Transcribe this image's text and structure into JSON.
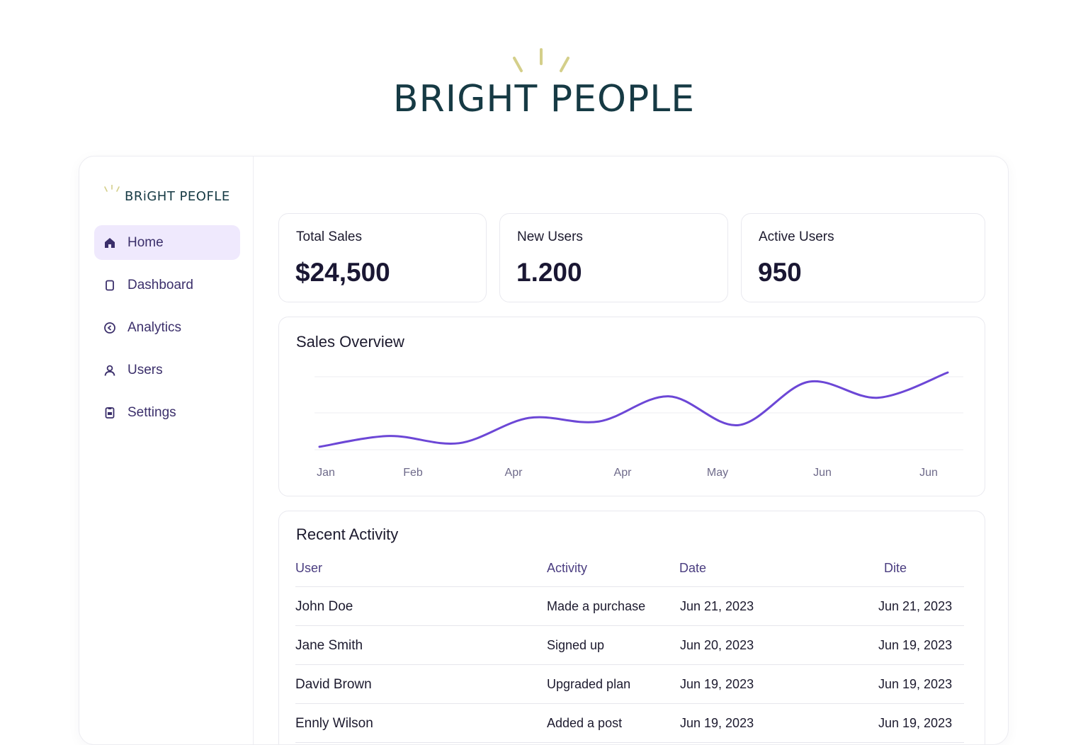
{
  "brand": {
    "name": "BRIGHT PEOPLE",
    "colors": {
      "primary": "#163a44",
      "rays": "#d4cf8a",
      "accent": "#6c47d6"
    }
  },
  "sidebar": {
    "logo_text": "BRiGHT PEOFLE",
    "items": [
      {
        "label": "Home",
        "icon": "home-icon",
        "active": true
      },
      {
        "label": "Dashboard",
        "icon": "dashboard-icon",
        "active": false
      },
      {
        "label": "Analytics",
        "icon": "analytics-icon",
        "active": false
      },
      {
        "label": "Users",
        "icon": "user-icon",
        "active": false
      },
      {
        "label": "Settings",
        "icon": "settings-icon",
        "active": false
      }
    ]
  },
  "stats": [
    {
      "label": "Total Sales",
      "value": "$24,500"
    },
    {
      "label": "New Users",
      "value": "1.200"
    },
    {
      "label": "Active Users",
      "value": "950"
    }
  ],
  "chart_data": {
    "type": "line",
    "title": "Sales Overview",
    "categories": [
      "Jan",
      "Feb",
      "Apr",
      "Apr",
      "May",
      "Jun",
      "Jun"
    ],
    "series": [
      {
        "values": [
          0.05,
          0.2,
          0.1,
          0.45,
          0.4,
          0.75,
          0.35,
          0.95,
          0.73,
          1.08
        ]
      }
    ],
    "grid": true,
    "color": "#6c47d6"
  },
  "activity": {
    "title": "Recent Activity",
    "columns": [
      "User",
      "Activity",
      "Date",
      "Dite"
    ],
    "rows": [
      {
        "user": "John Doe",
        "activity": "Made a purchase",
        "date": "Jun 21, 2023",
        "date2": "Jun 21, 2023"
      },
      {
        "user": "Jane Smith",
        "activity": "Signed up",
        "date": "Jun 20, 2023",
        "date2": "Jun 19, 2023"
      },
      {
        "user": "David Brown",
        "activity": "Upgraded plan",
        "date": "Jun 19, 2023",
        "date2": "Jun 19, 2023"
      },
      {
        "user": "Ennly Wilson",
        "activity": "Added a post",
        "date": "Jun 19, 2023",
        "date2": "Jun 19, 2023"
      }
    ]
  }
}
